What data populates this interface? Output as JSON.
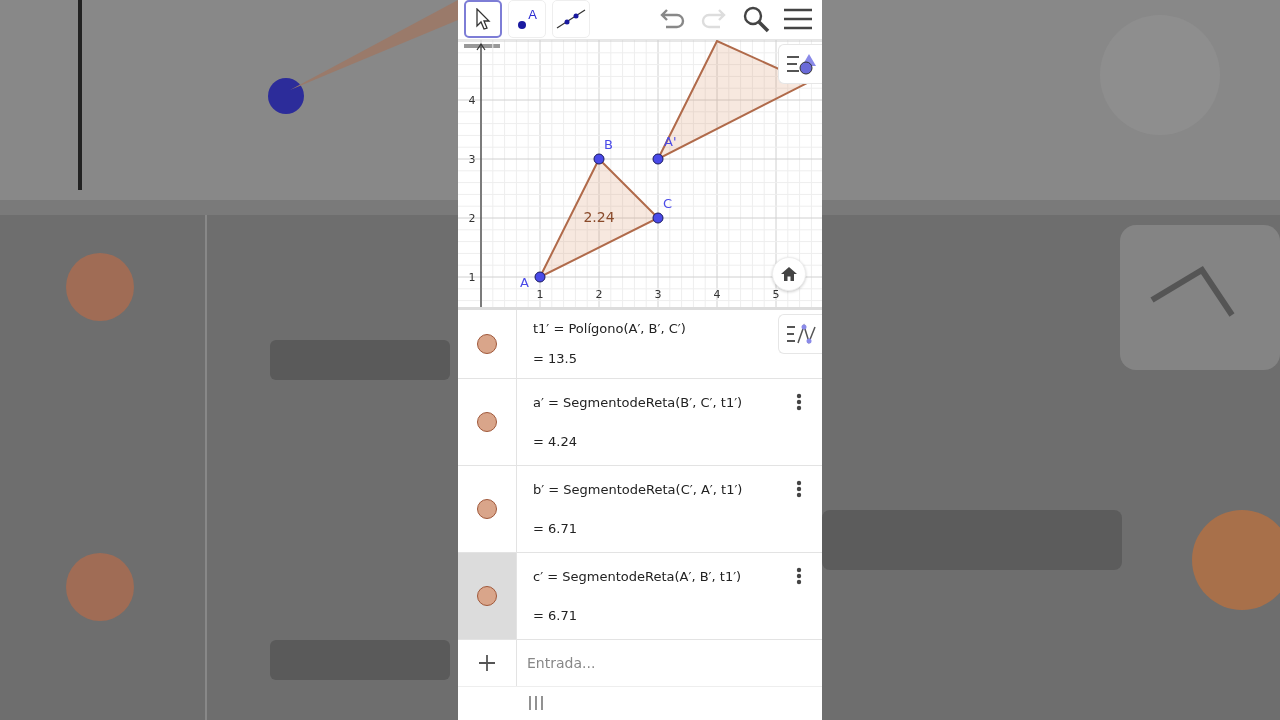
{
  "toolbar": {
    "tools": [
      {
        "kind": "move",
        "selected": true
      },
      {
        "kind": "point",
        "label": "A",
        "selected": false
      },
      {
        "kind": "line",
        "selected": false
      }
    ],
    "undo": {
      "disabled": false
    },
    "redo": {
      "disabled": true
    }
  },
  "graphics": {
    "x_tick_labels": [
      "1",
      "2",
      "3",
      "4",
      "5"
    ],
    "y_tick_labels": [
      "4",
      "3",
      "2",
      "1"
    ],
    "points": [
      {
        "label": "B"
      },
      {
        "label": "A'"
      },
      {
        "label": "C"
      },
      {
        "label": "A"
      }
    ],
    "value_label": "2.24"
  },
  "algebra": {
    "rows": [
      {
        "definition": "t1′ = Polígono(A′, B′, C′)",
        "value": "= 13.5",
        "selected": false,
        "kind": "partial"
      },
      {
        "definition": "a′ = SegmentodeReta(B′, C′, t1′)",
        "value": "= 4.24",
        "selected": false,
        "kind": "full"
      },
      {
        "definition": "b′ = SegmentodeReta(C′, A′, t1′)",
        "value": "= 6.71",
        "selected": false,
        "kind": "full"
      },
      {
        "definition": "c′ = SegmentodeReta(A′, B′, t1′)",
        "value": "= 6.71",
        "selected": true,
        "kind": "full"
      }
    ],
    "input": {
      "placeholder": "Entrada..."
    }
  }
}
